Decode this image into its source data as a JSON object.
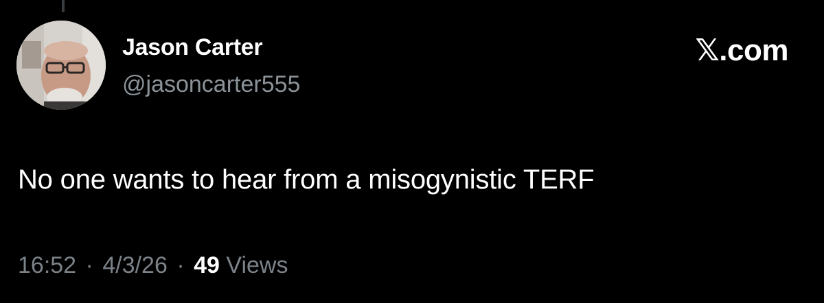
{
  "author": {
    "display_name": "Jason Carter",
    "handle": "@jasoncarter555",
    "avatar_icon": "profile-photo"
  },
  "brand": {
    "label": "𝕏.com"
  },
  "post": {
    "text": "No one wants to hear from a misogynistic TERF"
  },
  "meta": {
    "time": "16:52",
    "separator": "·",
    "date": "4/3/26",
    "views_count": "49",
    "views_label": "Views"
  },
  "colors": {
    "background": "#000000",
    "primary_text": "#ffffff",
    "secondary_text": "#8b9298"
  }
}
